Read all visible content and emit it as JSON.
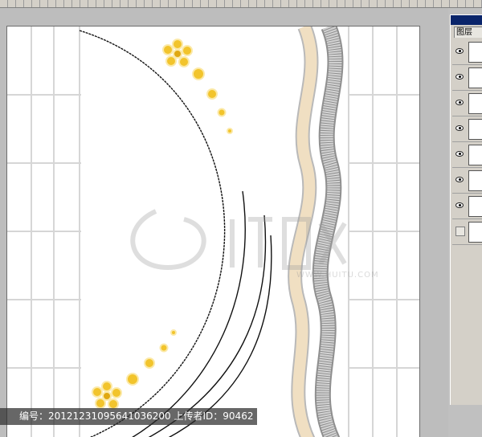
{
  "layers_panel": {
    "tab_label": "图层",
    "rows": [
      {
        "visible": true
      },
      {
        "visible": true
      },
      {
        "visible": true
      },
      {
        "visible": true
      },
      {
        "visible": true
      },
      {
        "visible": true
      },
      {
        "visible": true
      },
      {
        "visible": false
      }
    ]
  },
  "watermark": {
    "footer_text": "编号：20121231095641036200 上传者ID：90462",
    "site_text": "WWW.HUITU.COM"
  },
  "colors": {
    "flower": "#f2c42c",
    "wave_beige": "#f0dfc2",
    "wave_gray": "#c8c8c8",
    "tile_lines": "#d6d6d6",
    "arc_lines": "#111111"
  }
}
